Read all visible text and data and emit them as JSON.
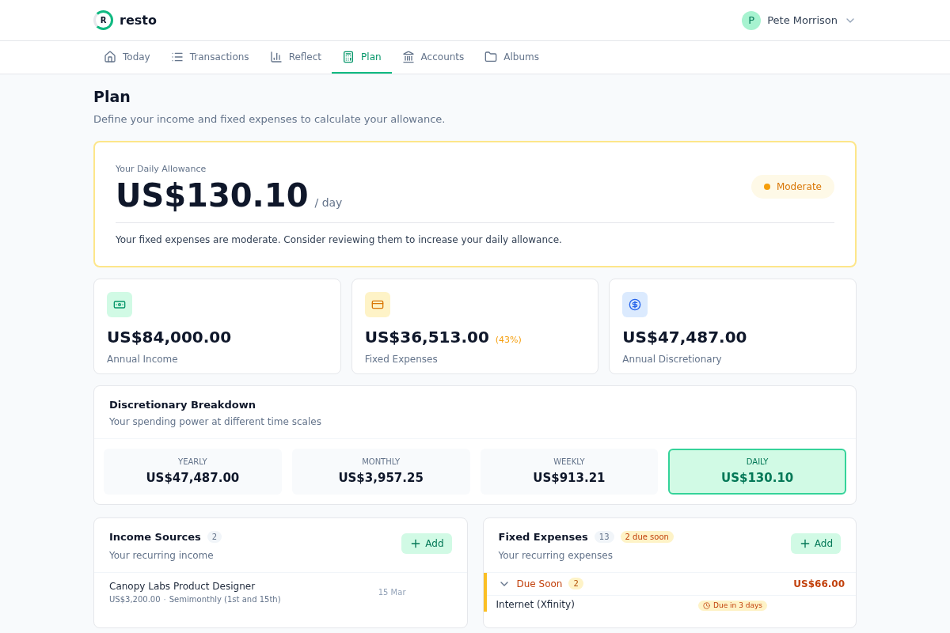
{
  "header": {
    "logo_letter": "R",
    "brand": "resto",
    "user": {
      "initial": "P",
      "name": "Pete Morrison"
    }
  },
  "nav": [
    {
      "label": "Today",
      "selected": false
    },
    {
      "label": "Transactions",
      "selected": false
    },
    {
      "label": "Reflect",
      "selected": false
    },
    {
      "label": "Plan",
      "selected": true
    },
    {
      "label": "Accounts",
      "selected": false
    },
    {
      "label": "Albums",
      "selected": false
    }
  ],
  "page": {
    "title": "Plan",
    "subtitle": "Define your income and fixed expenses to calculate your allowance."
  },
  "allowance": {
    "label": "Your Daily Allowance",
    "amount": "US$130.10",
    "unit": "/ day",
    "status": "Moderate",
    "message": "Your fixed expenses are moderate. Consider reviewing them to increase your daily allowance."
  },
  "stats": [
    {
      "amount": "US$84,000.00",
      "label": "Annual Income"
    },
    {
      "amount": "US$36,513.00",
      "percent": "(43%)",
      "label": "Fixed Expenses"
    },
    {
      "amount": "US$47,487.00",
      "label": "Annual Discretionary"
    }
  ],
  "breakdown": {
    "title": "Discretionary Breakdown",
    "subtitle": "Your spending power at different time scales",
    "items": [
      {
        "label": "YEARLY",
        "amount": "US$47,487.00",
        "selected": false
      },
      {
        "label": "MONTHLY",
        "amount": "US$3,957.25",
        "selected": false
      },
      {
        "label": "WEEKLY",
        "amount": "US$913.21",
        "selected": false
      },
      {
        "label": "DAILY",
        "amount": "US$130.10",
        "selected": true
      }
    ]
  },
  "income": {
    "title": "Income Sources",
    "count": "2",
    "subtitle": "Your recurring income",
    "add": "Add",
    "rows": [
      {
        "name": "Canopy Labs Product Designer",
        "amount": "US$3,200.00",
        "separator": "·",
        "schedule": "Semimonthly (1st and 15th)",
        "date": "15 Mar"
      }
    ]
  },
  "expenses": {
    "title": "Fixed Expenses",
    "count": "13",
    "badge": "2 due soon",
    "subtitle": "Your recurring expenses",
    "add": "Add",
    "group": {
      "title": "Due Soon",
      "count": "2",
      "total": "US$66.00",
      "expanded": true
    },
    "rows": [
      {
        "name": "Internet (Xfinity)",
        "due": "Due in 3 days"
      }
    ]
  }
}
